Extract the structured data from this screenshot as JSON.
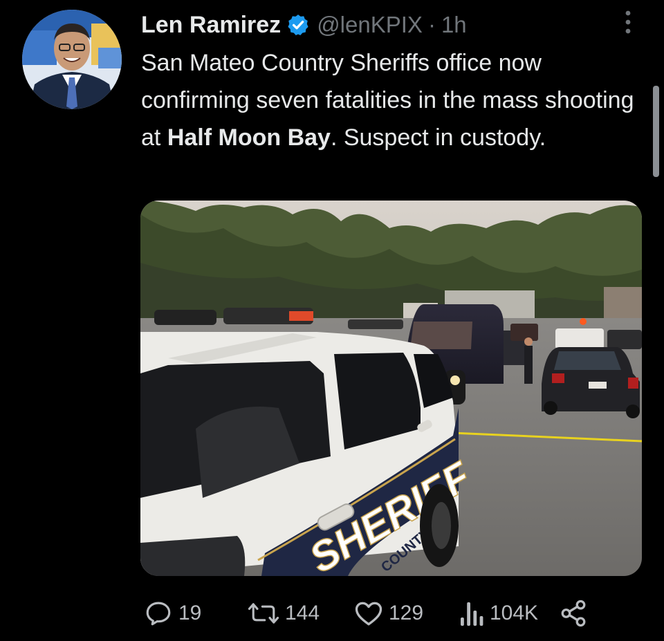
{
  "tweet": {
    "author_name": "Len Ramirez",
    "handle": "@lenKPIX",
    "separator": "·",
    "time": "1h",
    "text_part1": "San Mateo Country Sheriffs office now confirming seven fatalities in the mass shooting at ",
    "text_bold": "Half Moon Bay",
    "text_part2": ". Suspect in custody.",
    "image_text": {
      "door_word": "SHERIFF",
      "door_sub": "COUNTY"
    }
  },
  "actions": {
    "reply_count": "19",
    "retweet_count": "144",
    "like_count": "129",
    "views_count": "104K"
  },
  "icons": {
    "verified": "verified-badge-icon",
    "more": "more-options-icon",
    "reply": "reply-icon",
    "retweet": "retweet-icon",
    "like": "heart-icon",
    "views": "views-icon",
    "share": "share-icon"
  },
  "colors": {
    "background": "#000000",
    "text": "#e7e9ea",
    "secondary": "#71767b",
    "verified": "#1d9bf0"
  }
}
